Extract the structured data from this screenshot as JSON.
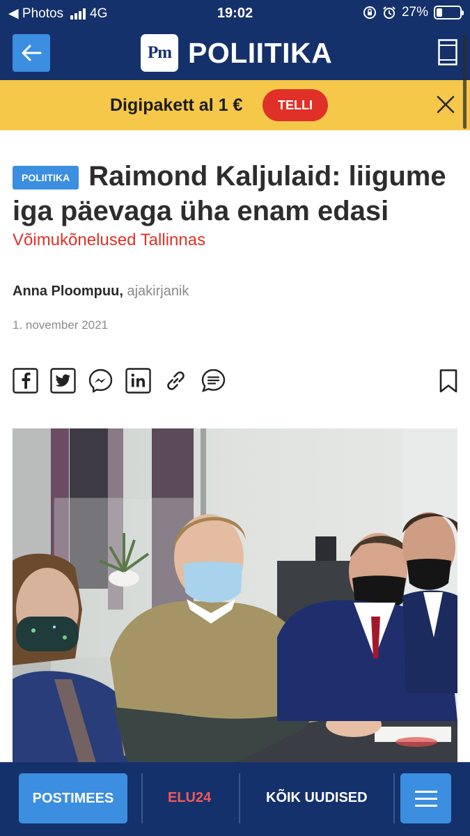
{
  "status_bar": {
    "back_app": "◀ Photos",
    "network": "4G",
    "time": "19:02",
    "battery": "27%"
  },
  "header": {
    "logo_text": "Pm",
    "title": "POLIITIKA"
  },
  "promo": {
    "text": "Digipakett al 1 €",
    "button": "TELLI"
  },
  "article": {
    "tag": "POLIITIKA",
    "headline": "Raimond Kaljulaid: liigume iga päevaga üha enam edasi",
    "subhead": "Võimukõnelused Tallinnas",
    "author_name": "Anna Ploompuu,",
    "author_role": "ajakirjanik",
    "date": "1. november 2021"
  },
  "share_icons": [
    "facebook-icon",
    "twitter-icon",
    "messenger-icon",
    "linkedin-icon",
    "link-icon",
    "comment-icon"
  ],
  "bottom_nav": {
    "postimees": "POSTIMEES",
    "elu24": "ELU24",
    "all_news": "KÕIK UUDISED"
  },
  "colors": {
    "brand_navy": "#15316b",
    "accent_blue": "#3c8ee0",
    "promo_yellow": "#f5c84a",
    "accent_red": "#e03128"
  }
}
